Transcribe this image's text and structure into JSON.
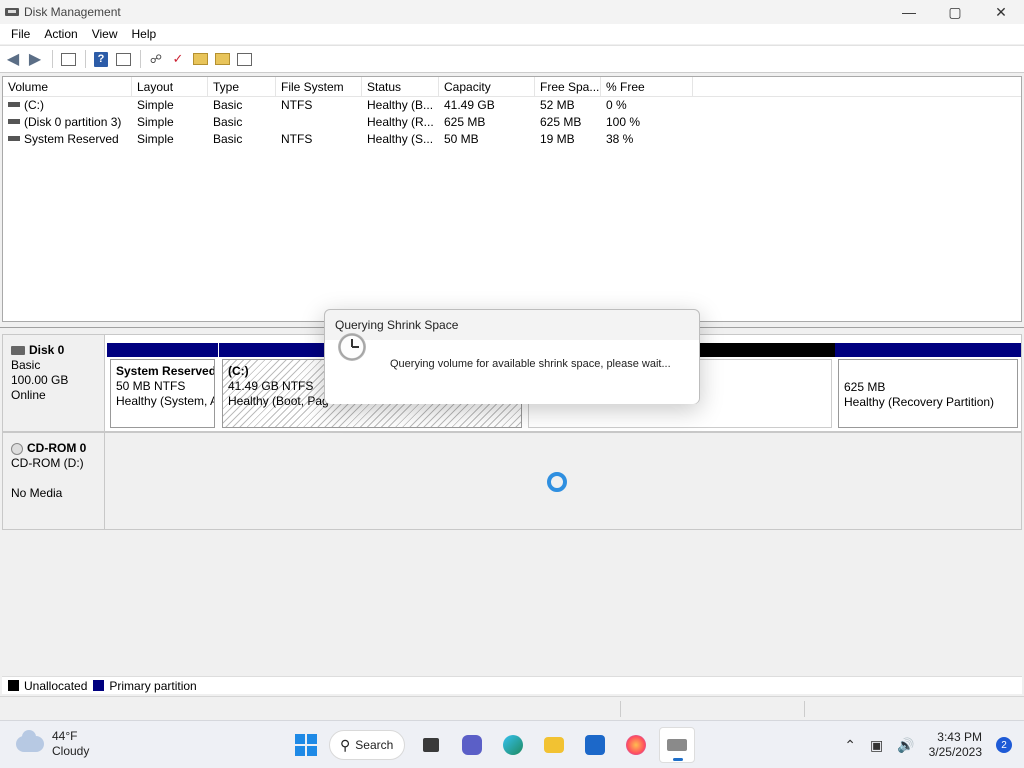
{
  "window": {
    "title": "Disk Management",
    "controls": {
      "minimize": "—",
      "maximize": "▢",
      "close": "✕"
    }
  },
  "menu": [
    "File",
    "Action",
    "View",
    "Help"
  ],
  "volume_list": {
    "columns": [
      "Volume",
      "Layout",
      "Type",
      "File System",
      "Status",
      "Capacity",
      "Free Spa...",
      "% Free"
    ],
    "rows": [
      {
        "volume": "(C:)",
        "layout": "Simple",
        "type": "Basic",
        "fs": "NTFS",
        "status": "Healthy (B...",
        "capacity": "41.49 GB",
        "free": "52 MB",
        "pct": "0 %"
      },
      {
        "volume": "(Disk 0 partition 3)",
        "layout": "Simple",
        "type": "Basic",
        "fs": "",
        "status": "Healthy (R...",
        "capacity": "625 MB",
        "free": "625 MB",
        "pct": "100 %"
      },
      {
        "volume": "System Reserved",
        "layout": "Simple",
        "type": "Basic",
        "fs": "NTFS",
        "status": "Healthy (S...",
        "capacity": "50 MB",
        "free": "19 MB",
        "pct": "38 %"
      }
    ]
  },
  "disks": {
    "disk0": {
      "name": "Disk 0",
      "type": "Basic",
      "size": "100.00 GB",
      "state": "Online",
      "partitions": {
        "sysres": {
          "name": "System Reserved",
          "size": "50 MB NTFS",
          "status": "Healthy (System, A"
        },
        "c": {
          "name": "(C:)",
          "size": "41.49 GB NTFS",
          "status": "Healthy (Boot, Pag"
        },
        "recovery": {
          "size": "625 MB",
          "status": "Healthy (Recovery Partition)"
        }
      }
    },
    "cdrom0": {
      "name": "CD-ROM 0",
      "drive": "CD-ROM (D:)",
      "media": "No Media"
    }
  },
  "legend": {
    "unallocated": "Unallocated",
    "primary": "Primary partition",
    "colors": {
      "unallocated": "#000000",
      "primary": "#00007f"
    }
  },
  "dialog": {
    "title": "Querying Shrink Space",
    "message": "Querying volume for available shrink space, please wait..."
  },
  "taskbar": {
    "weather": {
      "temp": "44°F",
      "condition": "Cloudy"
    },
    "search_label": "Search",
    "time": "3:43 PM",
    "date": "3/25/2023",
    "notification_count": "2"
  }
}
